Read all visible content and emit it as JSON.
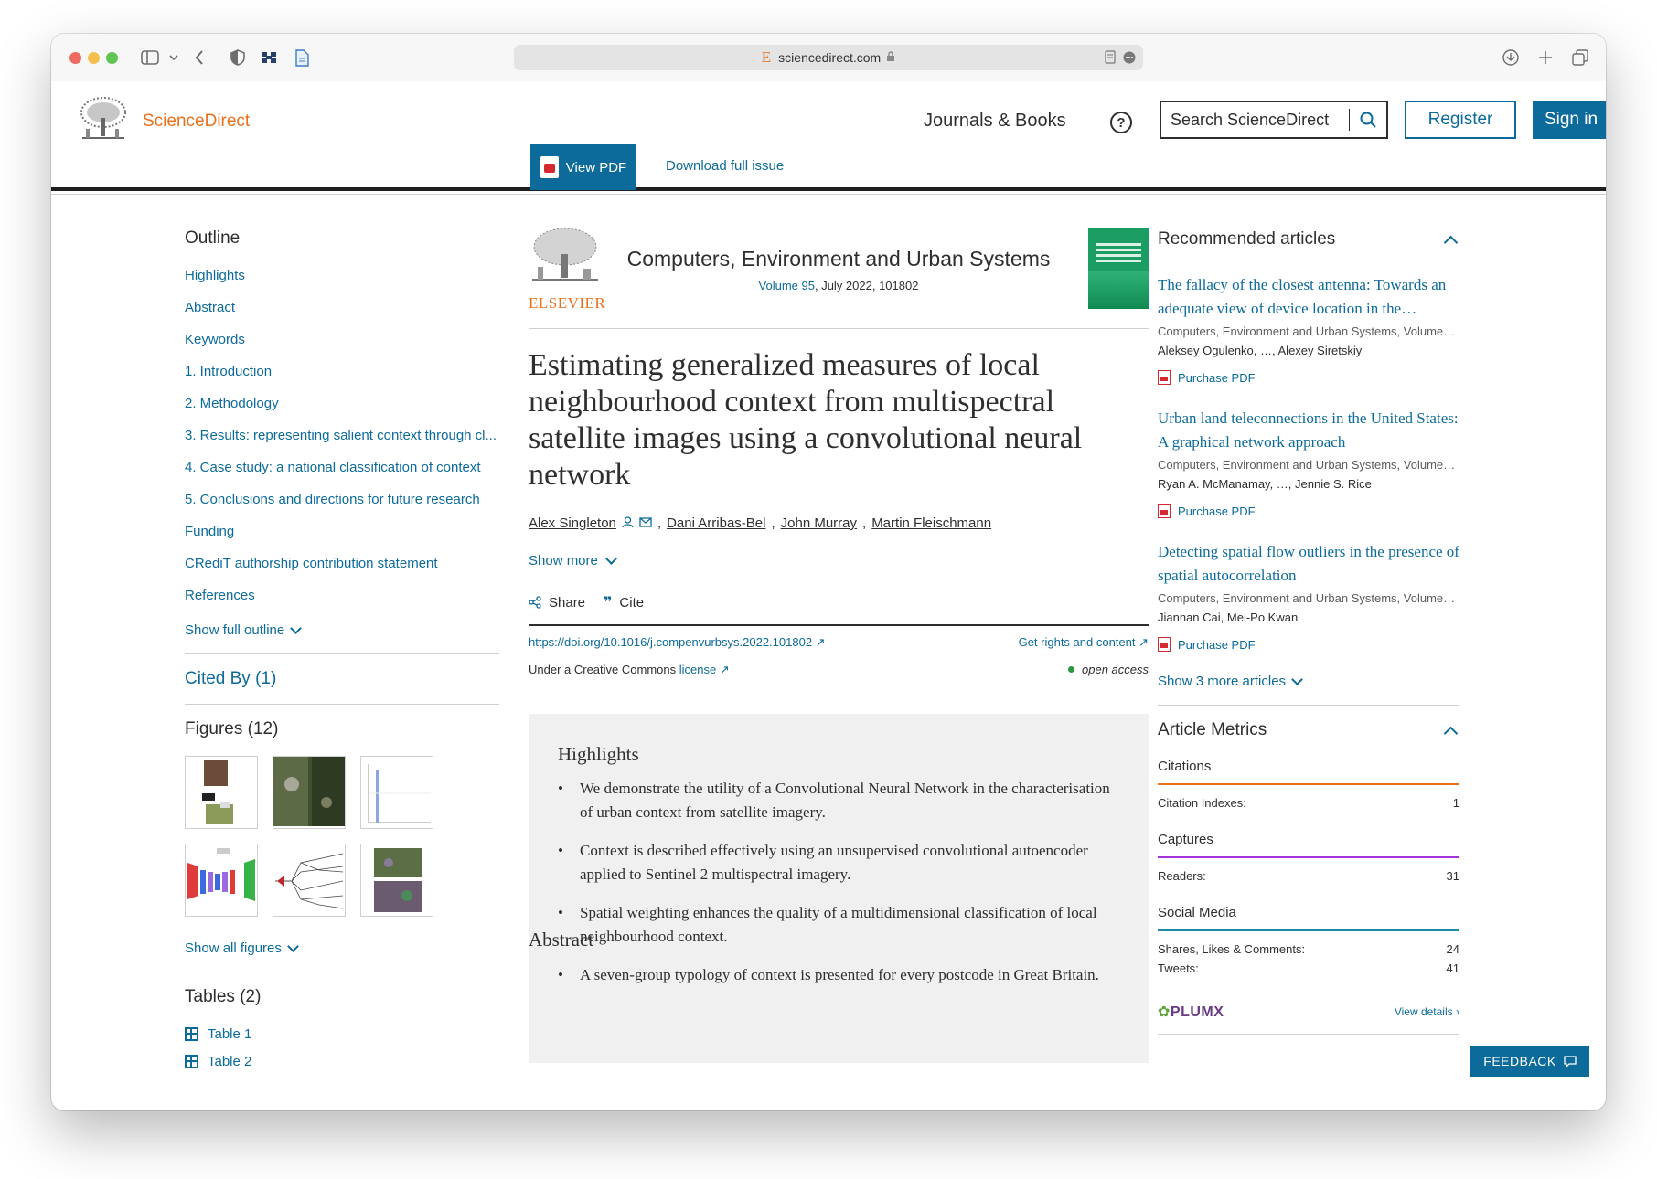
{
  "browser": {
    "url": "sciencedirect.com",
    "favicon_glyph": "E"
  },
  "header": {
    "brand": "ScienceDirect",
    "nav_journals": "Journals & Books",
    "help_glyph": "?",
    "search_placeholder": "Search ScienceDirect",
    "register": "Register",
    "signin": "Sign in"
  },
  "toolbar": {
    "view_pdf": "View PDF",
    "download_issue": "Download full issue"
  },
  "outline": {
    "title": "Outline",
    "items": [
      "Highlights",
      "Abstract",
      "Keywords",
      "1. Introduction",
      "2. Methodology",
      "3. Results: representing salient context through cl...",
      "4. Case study: a national classification of context",
      "5. Conclusions and directions for future research",
      "Funding",
      "CRediT authorship contribution statement",
      "References"
    ],
    "show_full": "Show full outline",
    "cited_by": "Cited By (1)",
    "figures_title": "Figures (12)",
    "show_all_figures": "Show all figures",
    "tables_title": "Tables (2)",
    "tables": [
      "Table 1",
      "Table 2"
    ]
  },
  "article": {
    "publisher": "ELSEVIER",
    "journal": "Computers, Environment and Urban Systems",
    "volume_link": "Volume 95",
    "volume_rest": ", July 2022, 101802",
    "title": "Estimating generalized measures of local neighbourhood context from multispectral satellite images using a convolutional neural network",
    "authors": [
      "Alex Singleton",
      "Dani Arribas-Bel",
      "John Murray",
      "Martin Fleischmann"
    ],
    "show_more": "Show more",
    "share": "Share",
    "cite": "Cite",
    "doi": "https://doi.org/10.1016/j.compenvurbsys.2022.101802 ↗",
    "rights": "Get rights and content ↗",
    "license_prefix": "Under a Creative Commons ",
    "license_link": "license ↗",
    "open_access": "open access",
    "highlights_title": "Highlights",
    "highlights": [
      "We demonstrate the utility of a Convolutional Neural Network in the characterisation of urban context from satellite imagery.",
      "Context is described effectively using an unsupervised convolutional autoencoder applied to Sentinel 2 multispectral imagery.",
      "Spatial weighting enhances the quality of a multidimensional classification of local neighbourhood context.",
      "A seven-group typology of context is presented for every postcode in Great Britain."
    ],
    "abstract_title": "Abstract"
  },
  "recommended": {
    "title": "Recommended articles",
    "items": [
      {
        "title": "The fallacy of the closest antenna: Towards an adequate view of device location in the…",
        "source": "Computers, Environment and Urban Systems, Volume…",
        "authors": "Aleksey Ogulenko, …, Alexey Siretskiy",
        "pdf": "Purchase PDF"
      },
      {
        "title": "Urban land teleconnections in the United States: A graphical network approach",
        "source": "Computers, Environment and Urban Systems, Volume…",
        "authors": "Ryan A. McManamay, …, Jennie S. Rice",
        "pdf": "Purchase PDF"
      },
      {
        "title": "Detecting spatial flow outliers in the presence of spatial autocorrelation",
        "source": "Computers, Environment and Urban Systems, Volume…",
        "authors": "Jiannan Cai, Mei-Po Kwan",
        "pdf": "Purchase PDF"
      }
    ],
    "show_more": "Show 3 more articles"
  },
  "metrics": {
    "title": "Article Metrics",
    "citations_label": "Citations",
    "citation_indexes_label": "Citation Indexes:",
    "citation_indexes_value": "1",
    "captures_label": "Captures",
    "readers_label": "Readers:",
    "readers_value": "31",
    "social_label": "Social Media",
    "shares_label": "Shares, Likes & Comments:",
    "shares_value": "24",
    "tweets_label": "Tweets:",
    "tweets_value": "41",
    "plumx": "PLUMX",
    "view_details": "View details"
  },
  "feedback": "FEEDBACK"
}
